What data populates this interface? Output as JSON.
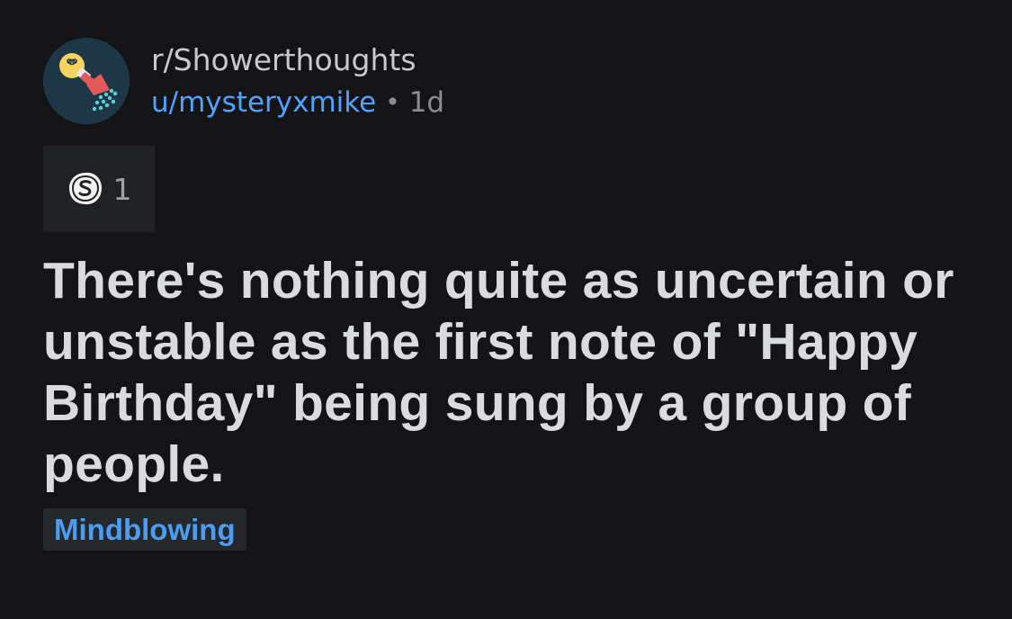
{
  "post": {
    "subreddit": "r/Showerthoughts",
    "author": "u/mysteryxmike",
    "separator": "•",
    "age": "1d",
    "award": {
      "icon": "silver-award-icon",
      "count": "1"
    },
    "title": "There's nothing quite as uncertain or unstable as the first note of \"Happy Birthday\" being sung by a group of people.",
    "flair": "Mindblowing"
  },
  "colors": {
    "background": "#141416",
    "author_link": "#4fa3ff",
    "flair_text": "#4a9df0",
    "flair_bg": "#26272a",
    "award_bg": "#202124"
  },
  "icons": {
    "subreddit_avatar": "lightbulb-shower-icon"
  }
}
